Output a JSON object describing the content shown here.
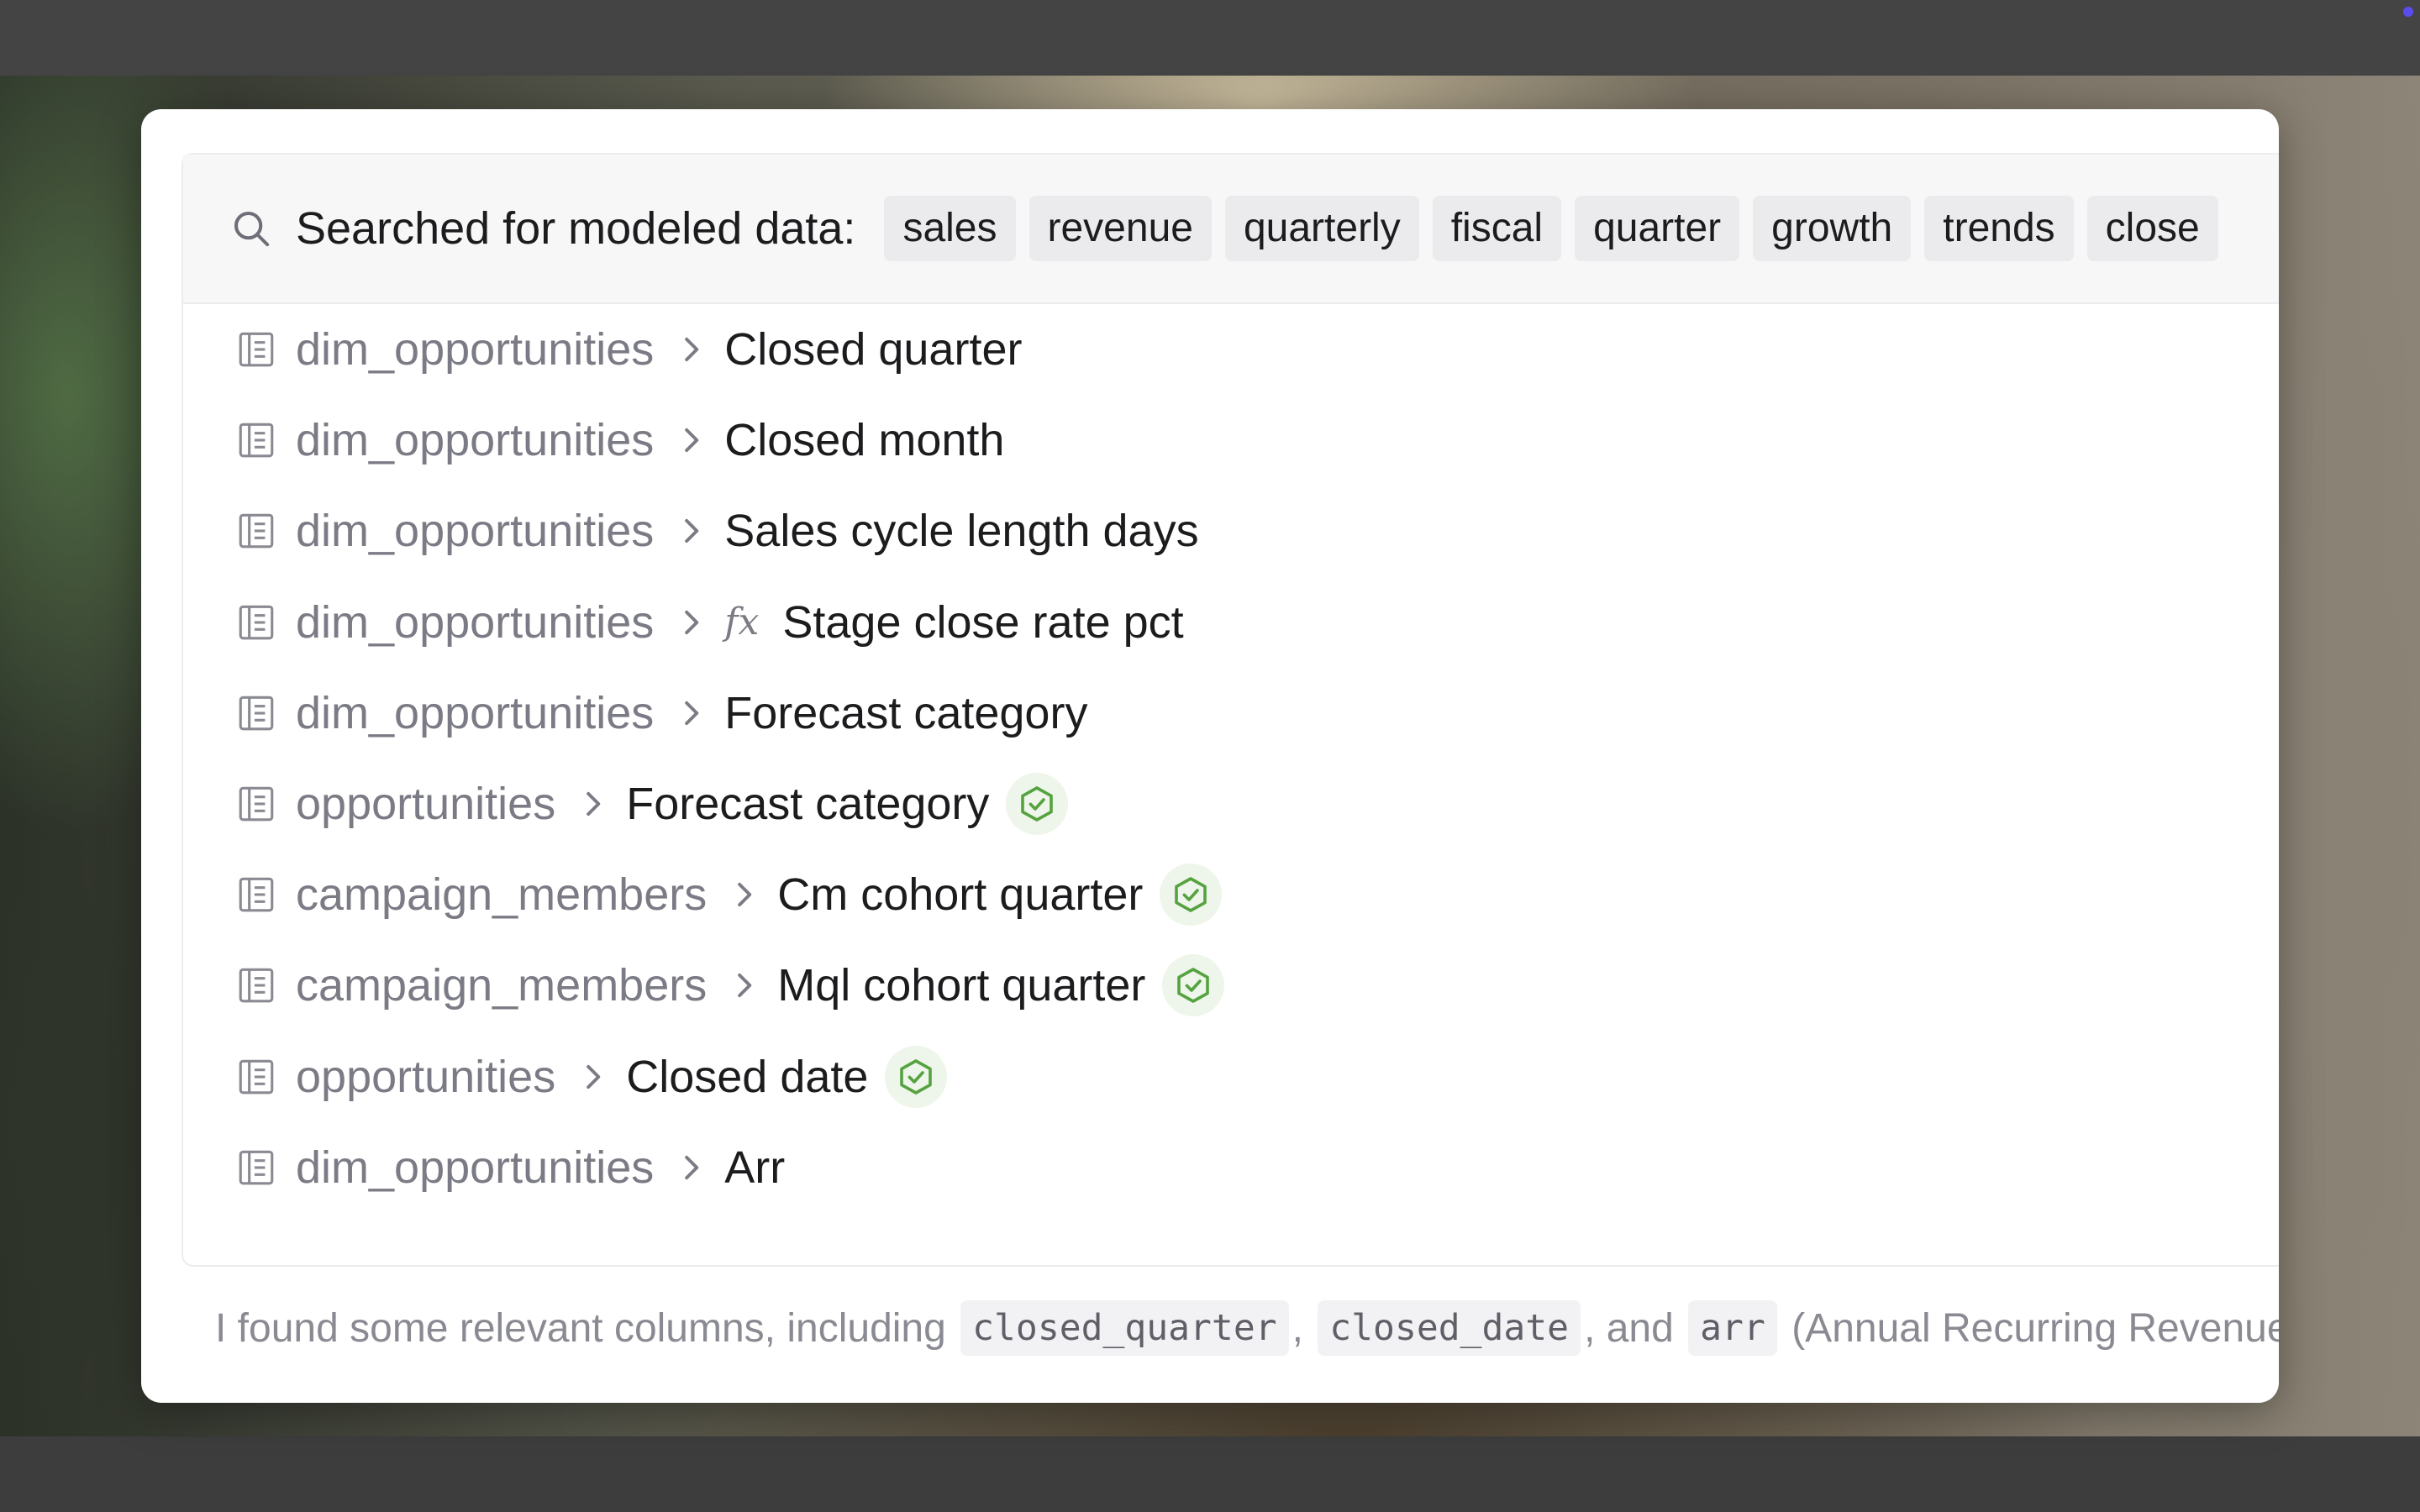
{
  "search": {
    "label": "Searched for modeled data:",
    "terms": [
      "sales",
      "revenue",
      "quarterly",
      "fiscal",
      "quarter",
      "growth",
      "trends",
      "close"
    ]
  },
  "results": [
    {
      "table": "dim_opportunities",
      "column": "Closed quarter",
      "formula": false,
      "verified": false
    },
    {
      "table": "dim_opportunities",
      "column": "Closed month",
      "formula": false,
      "verified": false
    },
    {
      "table": "dim_opportunities",
      "column": "Sales cycle length days",
      "formula": false,
      "verified": false
    },
    {
      "table": "dim_opportunities",
      "column": "Stage close rate pct",
      "formula": true,
      "verified": false
    },
    {
      "table": "dim_opportunities",
      "column": "Forecast category",
      "formula": false,
      "verified": false
    },
    {
      "table": "opportunities",
      "column": "Forecast category",
      "formula": false,
      "verified": true
    },
    {
      "table": "campaign_members",
      "column": "Cm cohort quarter",
      "formula": false,
      "verified": true
    },
    {
      "table": "campaign_members",
      "column": "Mql cohort quarter",
      "formula": false,
      "verified": true
    },
    {
      "table": "opportunities",
      "column": "Closed date",
      "formula": false,
      "verified": true
    },
    {
      "table": "dim_opportunities",
      "column": "Arr",
      "formula": false,
      "verified": false
    }
  ],
  "footer": {
    "prefix": "I found some relevant columns, including",
    "code1": "closed_quarter",
    "sep1": ",",
    "code2": "closed_date",
    "sep2": ", and",
    "code3": "arr",
    "suffix": "(Annual Recurring Revenue"
  },
  "icons": {
    "search": "search-icon",
    "table": "table-icon",
    "chevron": "chevron-right-icon",
    "formula": "fx",
    "verified": "verified-badge-icon"
  },
  "colors": {
    "verified_green": "#55a33f",
    "verified_bg": "#eef5ea",
    "accent_dot": "#5b4cf0"
  }
}
